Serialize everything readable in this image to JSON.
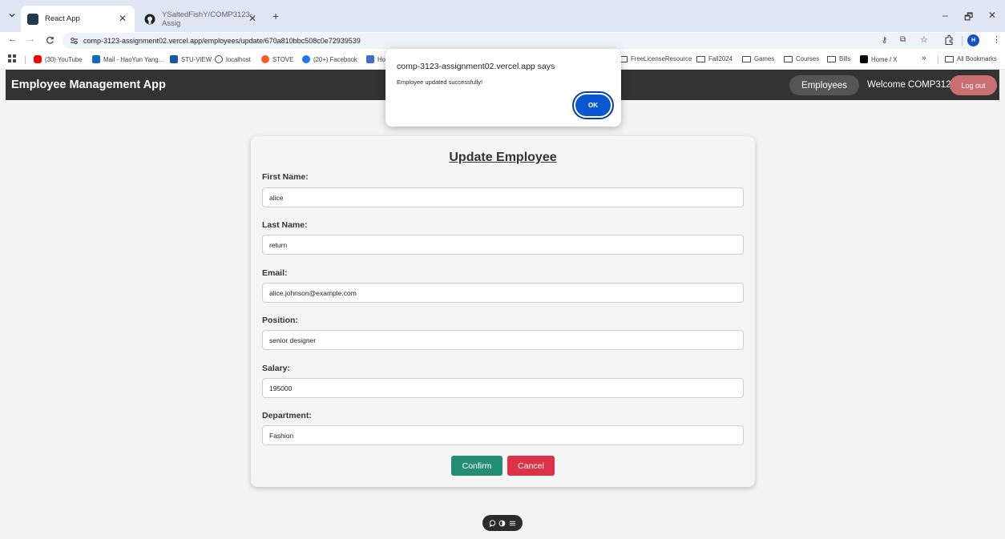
{
  "browser": {
    "tabs": [
      {
        "title": "React App"
      },
      {
        "title": "YSaltedFishY/COMP3123-Assig"
      }
    ],
    "url": "comp-3123-assignment02.vercel.app/employees/update/670a810bbc508c0e72939539",
    "profile_initial": "H",
    "bookmarks": [
      {
        "label": "(30) YouTube"
      },
      {
        "label": "Mail - HaoYun Yang..."
      },
      {
        "label": "STU-VIEW"
      },
      {
        "label": "localhost"
      },
      {
        "label": "STOVE"
      },
      {
        "label": "(20+) Facebook"
      },
      {
        "label": "Ho"
      },
      {
        "label": "FreeLicenseResource"
      },
      {
        "label": "Fall2024"
      },
      {
        "label": "Games"
      },
      {
        "label": "Courses"
      },
      {
        "label": "Bills"
      },
      {
        "label": "Home / X"
      },
      {
        "label": "All Bookmarks"
      }
    ],
    "bookmarks_overflow": "»"
  },
  "app": {
    "brand": "Employee Management App",
    "nav_employees": "Employees",
    "welcome": "Welcome COMP3123",
    "logout": "Log out"
  },
  "form": {
    "title": "Update Employee",
    "fields": [
      {
        "label": "First Name:",
        "value": "alice"
      },
      {
        "label": "Last Name:",
        "value": "return"
      },
      {
        "label": "Email:",
        "value": "alice.johnson@example.com"
      },
      {
        "label": "Position:",
        "value": "senior designer"
      },
      {
        "label": "Salary:",
        "value": "195000"
      },
      {
        "label": "Department:",
        "value": "Fashion"
      }
    ],
    "confirm": "Confirm",
    "cancel": "Cancel"
  },
  "dialog": {
    "title": "comp-3123-assignment02.vercel.app says",
    "message": "Employee updated successfully!",
    "ok": "OK"
  },
  "colors": {
    "navbar": "#333333",
    "confirm": "#238d76",
    "cancel": "#dc3245",
    "logout": "#c97072",
    "dialog_ok": "#0b57d0"
  }
}
